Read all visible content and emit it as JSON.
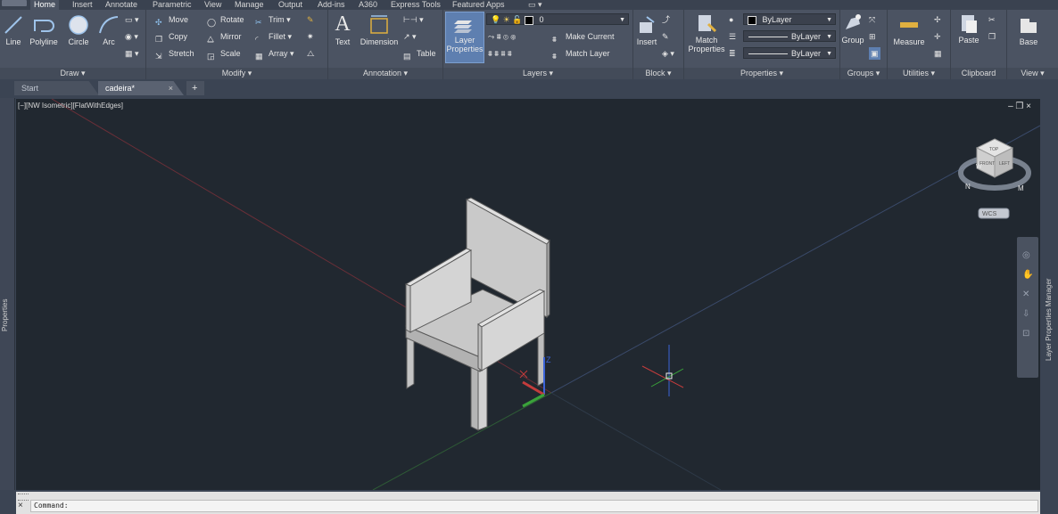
{
  "menu_tabs": [
    "Home",
    "Insert",
    "Annotate",
    "Parametric",
    "View",
    "Manage",
    "Output",
    "Add-ins",
    "A360",
    "Express Tools",
    "Featured Apps"
  ],
  "ribbon": {
    "draw": {
      "title": "Draw ▾",
      "line": "Line",
      "polyline": "Polyline",
      "circle": "Circle",
      "arc": "Arc"
    },
    "modify": {
      "title": "Modify ▾",
      "move": "Move",
      "rotate": "Rotate",
      "trim": "Trim",
      "copy": "Copy",
      "mirror": "Mirror",
      "fillet": "Fillet",
      "stretch": "Stretch",
      "scale": "Scale",
      "array": "Array"
    },
    "annotation": {
      "title": "Annotation ▾",
      "text": "Text",
      "dimension": "Dimension",
      "table": "Table"
    },
    "layers": {
      "title": "Layers ▾",
      "layer_properties_1": "Layer",
      "layer_properties_2": "Properties",
      "current_layer": "0",
      "make_current": "Make Current",
      "match_layer": "Match Layer"
    },
    "block": {
      "title": "Block ▾",
      "insert": "Insert"
    },
    "properties": {
      "title": "Properties ▾",
      "match_1": "Match",
      "match_2": "Properties",
      "color": "ByLayer",
      "linetype": "ByLayer",
      "lineweight": "ByLayer"
    },
    "groups": {
      "title": "Groups ▾",
      "group": "Group"
    },
    "utilities": {
      "title": "Utilities ▾",
      "measure": "Measure"
    },
    "clipboard": {
      "title": "Clipboard",
      "paste": "Paste"
    },
    "view": {
      "title": "View ▾",
      "base": "Base"
    }
  },
  "doc_tabs": {
    "start": "Start",
    "active": "cadeira*",
    "add": "+"
  },
  "viewport": {
    "label": "[−][NW Isometric][FlatWithEdges]",
    "controls": "– ❐ ×",
    "viewcube_top": "TOP",
    "viewcube_left": "LEFT",
    "viewcube_front": "FRONT",
    "compass_n": "N",
    "compass_w": "W",
    "compass_m": "M",
    "wcs": "WCS",
    "ucs_z": "Z"
  },
  "side_panels": {
    "left": "Properties",
    "right": "Layer Properties Manager"
  },
  "command": {
    "prompt": "Command:"
  },
  "colors": {
    "viewport_bg": "#212830",
    "ribbon_bg": "#4b5362",
    "chair_face": "#c9c9c9",
    "axis_x": "#c43c3c",
    "axis_y": "#3aa33a",
    "axis_z": "#3c64d8"
  }
}
